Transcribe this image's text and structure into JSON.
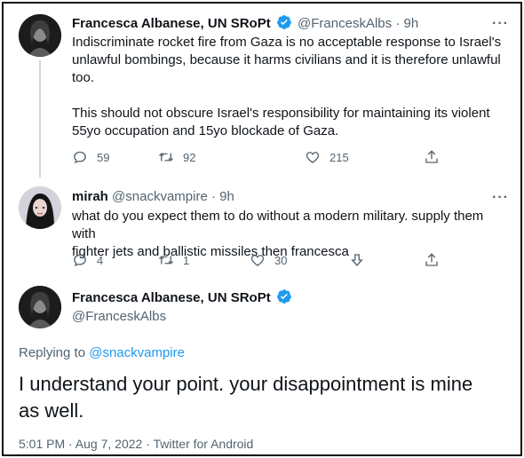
{
  "tweet1": {
    "author_name": "Francesca Albanese, UN SRoPt",
    "handle": "@FranceskAlbs",
    "separator": "·",
    "time": "9h",
    "text_p1_line1": "Indiscriminate rocket fire from Gaza is no acceptable response to Israel's",
    "text_p1_line2": "unlawful bombings, because it harms civilians and it is therefore unlawful",
    "text_p1_line3": "too.",
    "text_p2_line1": "This should not obscure Israel's responsibility for maintaining its violent",
    "text_p2_line2": "55yo occupation and 15yo blockade of Gaza.",
    "replies": "59",
    "retweets": "92",
    "likes": "215"
  },
  "tweet2": {
    "author_name": "mirah",
    "handle": "@snackvampire",
    "separator": "·",
    "time": "9h",
    "text_line1": "what do you expect them to do without a modern military. supply them with",
    "text_line2": "fighter jets and ballistic missiles then francesca",
    "replies": "4",
    "retweets": "1",
    "likes": "30"
  },
  "tweet3": {
    "author_name": "Francesca Albanese, UN SRoPt",
    "handle": "@FranceskAlbs",
    "replying_prefix": "Replying to",
    "replying_handle": "@snackvampire",
    "text_line1": "I understand your point. your disappointment is mine",
    "text_line2": "as well.",
    "footer": "5:01 PM · Aug 7, 2022 · Twitter for Android"
  },
  "icons": {
    "reply": "reply-icon",
    "retweet": "retweet-icon",
    "like": "heart-icon",
    "share": "share-icon",
    "downvote": "downvote-icon",
    "verified": "verified-badge-icon",
    "more": "more-icon"
  },
  "colors": {
    "verified_blue": "#1d9bf0",
    "text_primary": "#0f1419",
    "text_secondary": "#536471",
    "link": "#1d9bf0"
  }
}
